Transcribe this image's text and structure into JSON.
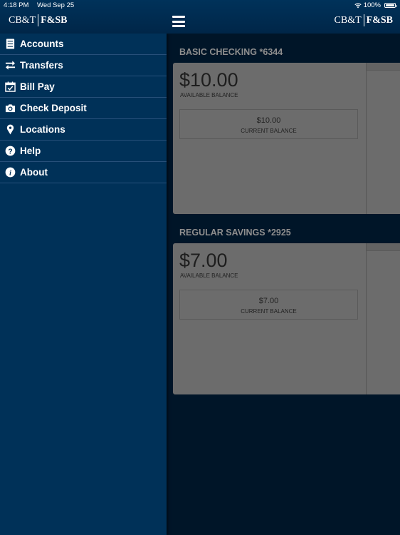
{
  "status_bar": {
    "time": "4:18 PM",
    "date": "Wed Sep 25",
    "battery_percent": "100%",
    "battery_level": 1.0
  },
  "header": {
    "logo_left_a": "CB&T",
    "logo_left_b": "F&SB",
    "logo_right_a": "CB&T",
    "logo_right_b": "F&SB",
    "menu_icon": "hamburger-icon"
  },
  "sidebar": {
    "items": [
      {
        "label": "Accounts",
        "icon": "accounts-icon"
      },
      {
        "label": "Transfers",
        "icon": "transfer-arrows-icon"
      },
      {
        "label": "Bill Pay",
        "icon": "calendar-check-icon"
      },
      {
        "label": "Check Deposit",
        "icon": "camera-icon"
      },
      {
        "label": "Locations",
        "icon": "map-pin-icon"
      },
      {
        "label": "Help",
        "icon": "question-circle-icon"
      },
      {
        "label": "About",
        "icon": "info-circle-icon"
      }
    ]
  },
  "accounts": [
    {
      "title": "BASIC CHECKING *6344",
      "available_balance": "$10.00",
      "available_label": "AVAILABLE BALANCE",
      "current_balance": "$10.00",
      "current_label": "CURRENT BALANCE"
    },
    {
      "title": "REGULAR SAVINGS *2925",
      "available_balance": "$7.00",
      "available_label": "AVAILABLE BALANCE",
      "current_balance": "$7.00",
      "current_label": "CURRENT BALANCE"
    }
  ],
  "colors": {
    "brand_navy": "#003158",
    "overlay_dark": "#001528",
    "text_white": "#ffffff"
  }
}
